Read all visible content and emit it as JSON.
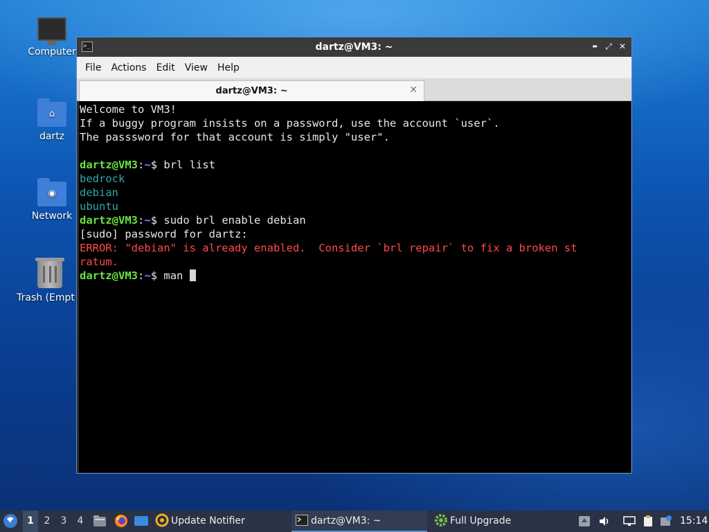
{
  "desktop": {
    "icons": [
      {
        "label": "Computer",
        "icon": "computer-icon"
      },
      {
        "label": "dartz",
        "icon": "home-folder-icon"
      },
      {
        "label": "Network",
        "icon": "network-folder-icon"
      },
      {
        "label": "Trash (Empt",
        "icon": "trash-icon"
      }
    ]
  },
  "window": {
    "title": "dartz@VM3: ~",
    "menu": [
      "File",
      "Actions",
      "Edit",
      "View",
      "Help"
    ],
    "tab": {
      "title": "dartz@VM3: ~",
      "close_glyph": "✕"
    },
    "buttons": {
      "minimize": "▬",
      "maximize": "⤢",
      "close": "✕"
    }
  },
  "terminal": {
    "lines": [
      "Welcome to VM3!",
      "If a buggy program insists on a password, use the account `user`.",
      "The passsword for that account is simply \"user\".",
      "",
      "bedrock",
      "debian",
      "ubuntu",
      "[sudo] password for dartz:",
      "ERROR: \"debian\" is already enabled.  Consider `brl repair` to fix a broken st",
      "ratum."
    ],
    "prompt_user": "dartz@VM3",
    "prompt_colon": ":",
    "prompt_path": "~",
    "prompt_dollar": "$ ",
    "commands": [
      "brl list",
      "sudo brl enable debian",
      "man "
    ]
  },
  "taskbar": {
    "workspaces": [
      "1",
      "2",
      "3",
      "4"
    ],
    "active_workspace": "1",
    "tasks": [
      {
        "label": "Update Notifier",
        "icon": "update-notifier-icon"
      },
      {
        "label": "dartz@VM3: ~",
        "icon": "terminal-icon"
      },
      {
        "label": "Full Upgrade",
        "icon": "gear-icon"
      }
    ],
    "clock": "15:14"
  },
  "colors": {
    "prompt_user": "#6be33e",
    "prompt_path": "#6a8cff",
    "list_output": "#2eaaa7",
    "error": "#ff4a4a",
    "taskbar": "#2a3245"
  }
}
